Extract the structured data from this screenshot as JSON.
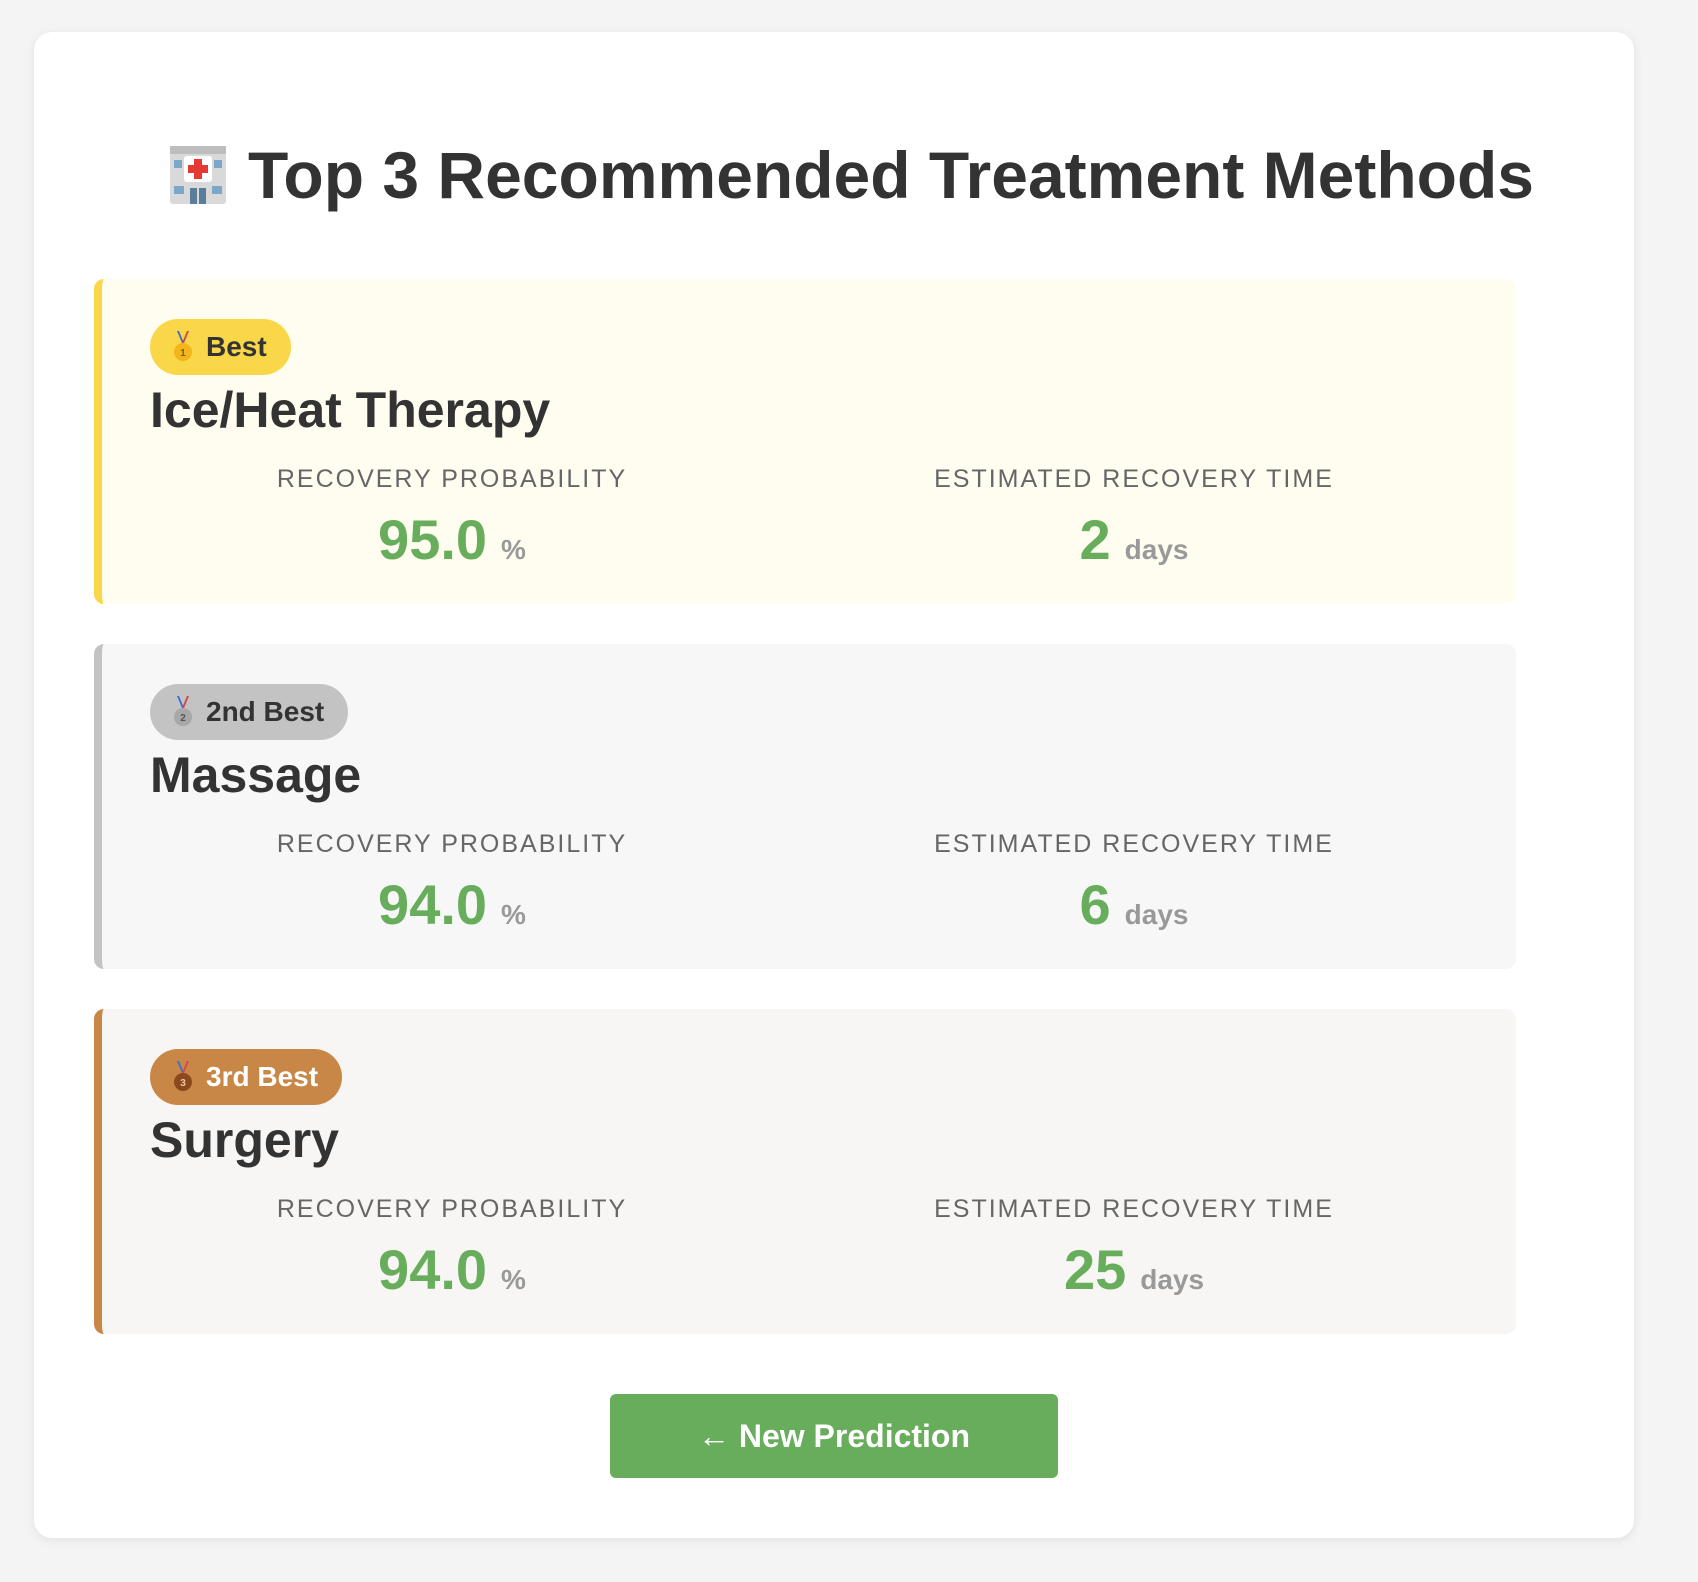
{
  "header": {
    "title": "Top 3 Recommended Treatment Methods",
    "icon": "hospital-icon"
  },
  "treatments": [
    {
      "badge": "Best",
      "medal_icon": "gold-medal-icon",
      "name": "Ice/Heat Therapy",
      "probability_label": "RECOVERY PROBABILITY",
      "probability_value": "95.0",
      "probability_unit": "%",
      "time_label": "ESTIMATED RECOVERY TIME",
      "time_value": "2",
      "time_unit": "days",
      "accent_color": "#fad748"
    },
    {
      "badge": "2nd Best",
      "medal_icon": "silver-medal-icon",
      "name": "Massage",
      "probability_label": "RECOVERY PROBABILITY",
      "probability_value": "94.0",
      "probability_unit": "%",
      "time_label": "ESTIMATED RECOVERY TIME",
      "time_value": "6",
      "time_unit": "days",
      "accent_color": "#c3c3c3"
    },
    {
      "badge": "3rd Best",
      "medal_icon": "bronze-medal-icon",
      "name": "Surgery",
      "probability_label": "RECOVERY PROBABILITY",
      "probability_value": "94.0",
      "probability_unit": "%",
      "time_label": "ESTIMATED RECOVERY TIME",
      "time_value": "25",
      "time_unit": "days",
      "accent_color": "#c98747"
    }
  ],
  "actions": {
    "new_prediction_label": "← New Prediction"
  },
  "colors": {
    "value_green": "#67ad5b",
    "button_green": "#67ad5b",
    "gold": "#fad748",
    "silver": "#c3c3c3",
    "bronze": "#c98747"
  }
}
